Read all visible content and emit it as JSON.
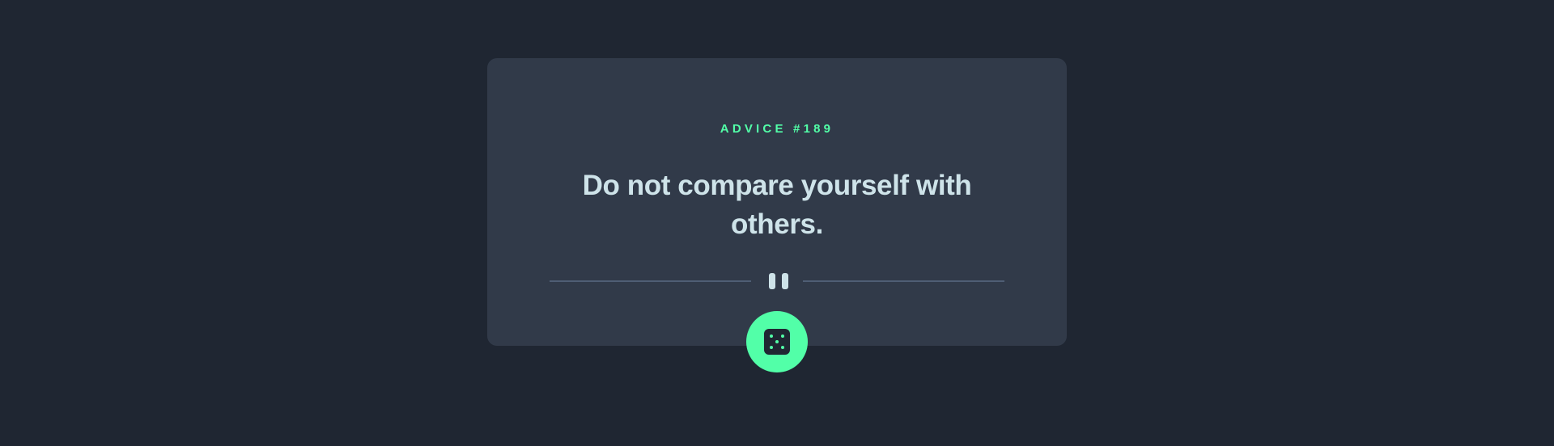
{
  "advice": {
    "id_label": "ADVICE #189",
    "text": "Do not compare yourself with others."
  },
  "icons": {
    "divider": "pause-icon",
    "button": "dice-icon"
  },
  "colors": {
    "background": "#1f2632",
    "card": "#313a49",
    "accent": "#52ffa8",
    "text": "#cee3e9",
    "divider": "#4f5d74"
  }
}
